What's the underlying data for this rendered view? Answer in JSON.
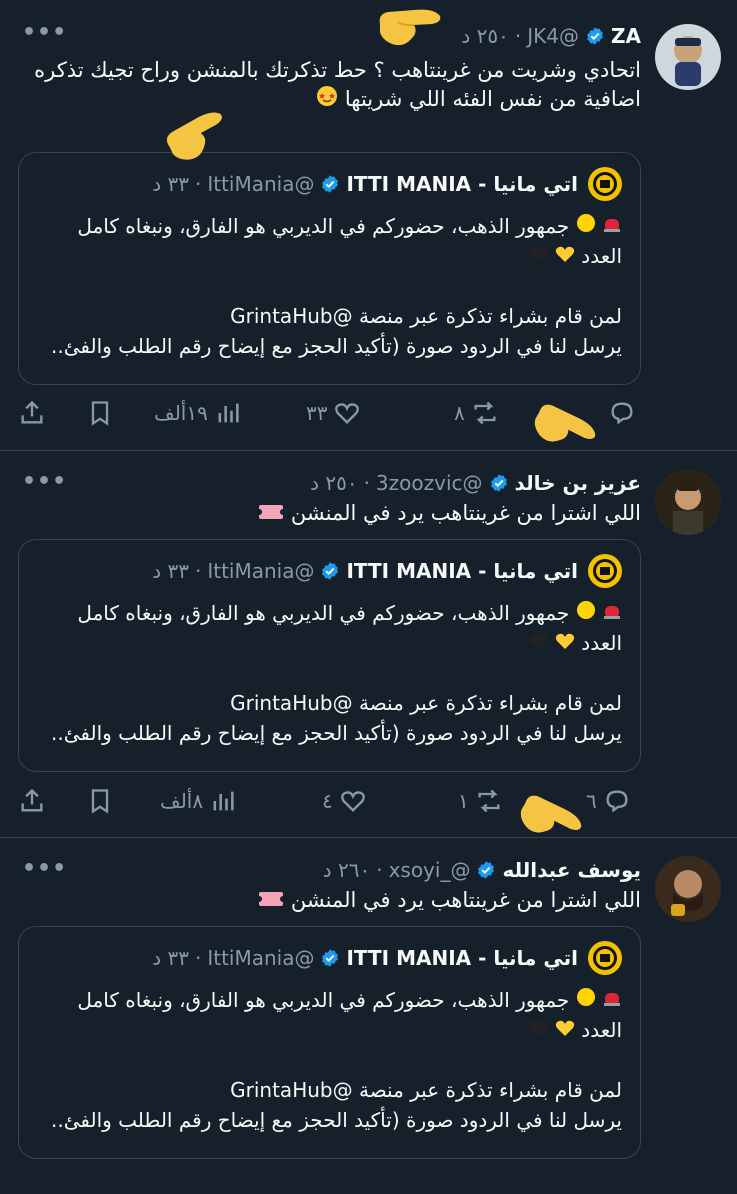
{
  "quoted_post": {
    "name": "اتي مانيا - ITTI MANIA",
    "handle": "@IttiMania",
    "time": "٣٣ د",
    "line1": "جمهور الذهب، حضوركم في الديربي هو الفارق، ونبغاه كامل العدد",
    "line2": "لمن قام بشراء تذكرة عبر منصة @GrintaHub",
    "line3": "يرسل لنا في الردود صورة (تأكيد الحجز مع إيضاح رقم الطلب والفئ.."
  },
  "tweets": [
    {
      "name": "ZA",
      "handle": "@JK4",
      "time": "٢٥٠ د",
      "text": "اتحادي وشريت من غرينتاهب ؟ حط تذكرتك بالمنشن وراح تجيك تذكره اضافية من نفس الفئه اللي شريتها",
      "replies": "",
      "reposts": "٨",
      "likes": "٣٣",
      "views": "١٩ألف"
    },
    {
      "name": "عزيز بن خالد",
      "handle": "@3zoozvic",
      "time": "٢٥٠ د",
      "text": "اللي اشترا من غرينتاهب يرد في المنشن",
      "replies": "٦",
      "reposts": "١",
      "likes": "٤",
      "views": "٨ألف"
    },
    {
      "name": "يوسف عبدالله",
      "handle": "@_xsoyi",
      "time": "٢٦٠ د",
      "text": "اللي اشترا من غرينتاهب يرد في المنشن"
    }
  ],
  "colors": {
    "background": "#15202b",
    "border": "#38444d",
    "muted": "#8b98a5",
    "verified": "#1d9bf0"
  },
  "icons": [
    "more-icon",
    "verified-icon",
    "reply-icon",
    "repost-icon",
    "like-icon",
    "views-icon",
    "bookmark-icon",
    "share-icon",
    "pointing-hand-emoji",
    "ticket-emoji"
  ]
}
